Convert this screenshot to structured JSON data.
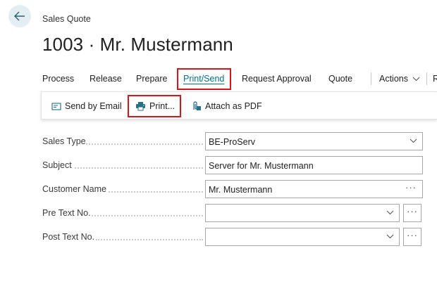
{
  "header": {
    "caption": "Sales Quote",
    "title": "1003 · Mr. Mustermann"
  },
  "actionbar": {
    "items": [
      {
        "label": "Process"
      },
      {
        "label": "Release"
      },
      {
        "label": "Prepare"
      },
      {
        "label": "Print/Send"
      },
      {
        "label": "Request Approval"
      },
      {
        "label": "Quote"
      },
      {
        "label": "Actions"
      },
      {
        "label": "R"
      }
    ],
    "active": "Print/Send"
  },
  "subactions": {
    "send_email": "Send by Email",
    "print": "Print...",
    "attach_pdf": "Attach as PDF"
  },
  "form": {
    "sales_type": {
      "label": "Sales Type",
      "value": "BE-ProServ"
    },
    "subject": {
      "label": "Subject",
      "value": "Server for Mr. Mustermann"
    },
    "customer_name": {
      "label": "Customer Name",
      "value": "Mr. Mustermann"
    },
    "pre_text_no": {
      "label": "Pre Text No.",
      "value": ""
    },
    "post_text_no": {
      "label": "Post Text No.",
      "value": ""
    }
  },
  "colors": {
    "accent": "#00718a",
    "highlight": "#d7151b",
    "back_button_bg": "#e3eef3"
  },
  "icons": [
    "back-arrow-icon",
    "chevron-down-icon",
    "email-icon",
    "printer-icon",
    "attach-pdf-icon",
    "ellipsis-icon"
  ]
}
